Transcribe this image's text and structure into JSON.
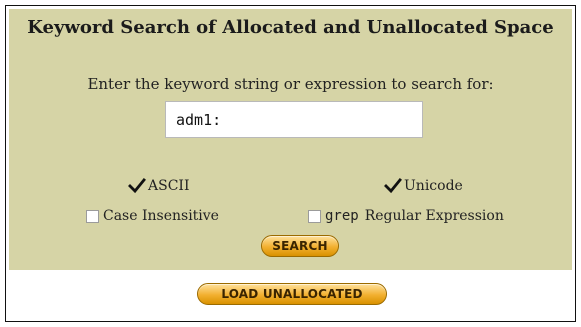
{
  "title": "Keyword Search of Allocated and Unallocated Space",
  "prompt": "Enter the keyword string or expression to search for:",
  "keyword": {
    "value": "adm1:"
  },
  "options": {
    "ascii": {
      "label": "ASCII",
      "checked": true
    },
    "unicode": {
      "label": "Unicode",
      "checked": true
    },
    "case_insensitive": {
      "label": "Case Insensitive",
      "checked": false
    },
    "grep": {
      "prefix": "grep",
      "label": "Regular Expression",
      "checked": false
    }
  },
  "buttons": {
    "search": "Search",
    "load_unallocated": "Load Unallocated"
  },
  "colors": {
    "panel": "#d6d4a6",
    "button_top": "#ffe29d",
    "button_mid": "#f2b030",
    "button_bottom": "#d99100"
  }
}
